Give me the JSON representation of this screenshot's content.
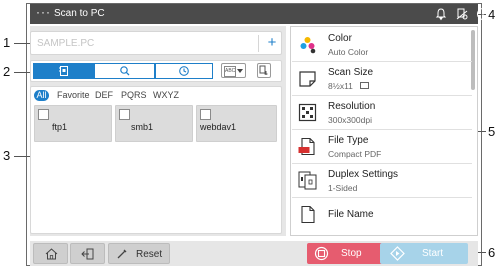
{
  "topbar": {
    "title": "Scan to PC",
    "menu_icon": "more-dots-icon",
    "icons": [
      "bell-icon",
      "connection-icon",
      "info-icon"
    ]
  },
  "address": {
    "placeholder": "SAMPLE.PC",
    "add_label": "+"
  },
  "toolbar": {
    "segments": [
      "address-book-icon",
      "search-icon",
      "history-icon"
    ],
    "sort_label": "ABC",
    "detail_icon": "detail-list-icon"
  },
  "filters": [
    "All",
    "Favorite",
    "DEF",
    "PQRS",
    "WXYZ"
  ],
  "destinations": [
    {
      "label": "ftp1"
    },
    {
      "label": "smb1"
    },
    {
      "label": "webdav1"
    }
  ],
  "settings": [
    {
      "title": "Color",
      "subtitle": "Auto Color",
      "icon": "color-icon"
    },
    {
      "title": "Scan Size",
      "subtitle": "8½x11",
      "icon": "scan-size-icon"
    },
    {
      "title": "Resolution",
      "subtitle": "300x300dpi",
      "icon": "resolution-icon"
    },
    {
      "title": "File Type",
      "subtitle": "Compact PDF",
      "icon": "file-type-icon"
    },
    {
      "title": "Duplex Settings",
      "subtitle": "1-Sided",
      "icon": "duplex-icon"
    },
    {
      "title": "File Name",
      "subtitle": "",
      "icon": "file-name-icon"
    }
  ],
  "bottom": {
    "home_icon": "home-icon",
    "return_icon": "return-icon",
    "reset_label": "Reset",
    "stop_label": "Stop",
    "start_label": "Start"
  },
  "callouts": [
    "1",
    "2",
    "3",
    "4",
    "5",
    "6"
  ],
  "colors": {
    "accent": "#1e7fc9",
    "stop": "#e65c6f",
    "start_disabled": "#a7d3e9",
    "topbar": "#4b4b4b"
  }
}
